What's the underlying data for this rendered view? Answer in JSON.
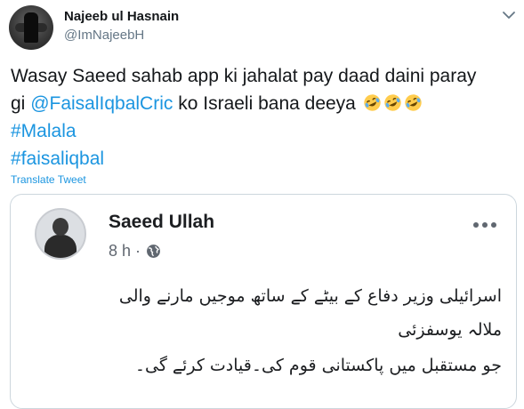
{
  "tweet": {
    "author_name": "Najeeb ul Hasnain",
    "author_handle": "@ImNajeebH",
    "text_line1": "Wasay Saeed sahab app ki jahalat pay daad daini paray",
    "text_line2_start": "gi ",
    "mention": "@FaisalIqbalCric",
    "text_line2_end": " ko Israeli bana deeya",
    "emoji": [
      "rolling-on-floor-laughing",
      "rolling-on-floor-laughing",
      "rolling-on-floor-laughing"
    ],
    "hashtags": [
      "#Malala",
      "#faisaliqbal"
    ],
    "translate_label": "Translate Tweet"
  },
  "embedded_post": {
    "author_name": "Saeed Ullah",
    "time": "8 h",
    "separator": "·",
    "lines": [
      "اسرائیلی وزیر دفاع کے بیٹے کے ساتھ موجیں مارنے والی",
      "ملالہ یوسفزئی",
      "جو مستقبل میں پاکستانی قوم کی۔قیادت کرئے گی۔"
    ]
  },
  "colors": {
    "link": "#1b95e0",
    "text": "#14171a",
    "secondary": "#657786",
    "border": "#ccd6dd"
  }
}
